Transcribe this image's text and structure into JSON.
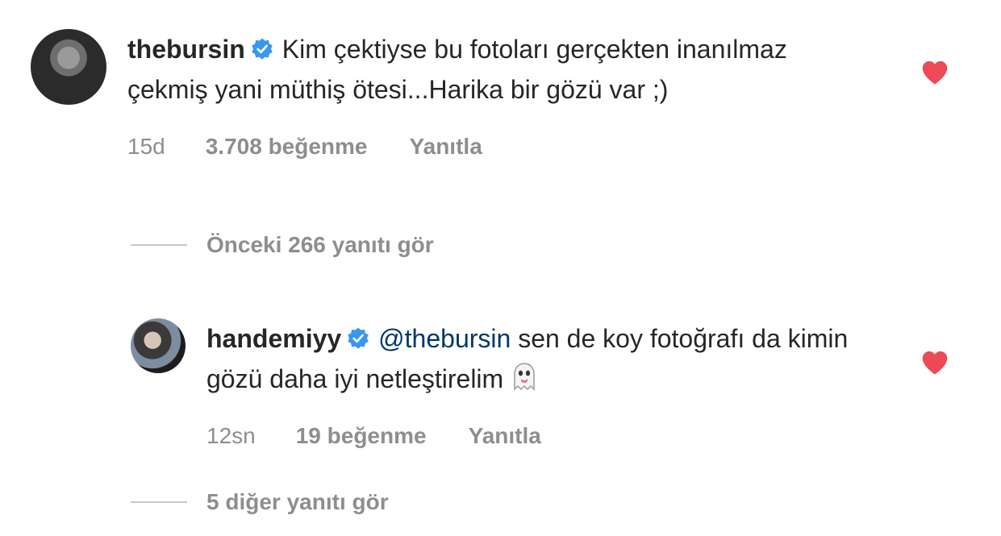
{
  "comments": [
    {
      "username": "thebursin",
      "verified": true,
      "text": "Kim çektiyse bu fotoları gerçekten inanılmaz çekmiş yani müthiş ötesi...Harika bir gözü var ;)",
      "time": "15d",
      "likes": "3.708 beğenme",
      "reply": "Yanıtla",
      "liked": true
    },
    {
      "username": "handemiyy",
      "verified": true,
      "mention": "@thebursin",
      "text": "sen de koy fotoğrafı da kimin gözü daha iyi netleştirelim",
      "emoji": "ghost",
      "time": "12sn",
      "likes": "19 beğenme",
      "reply": "Yanıtla",
      "liked": true
    }
  ],
  "view_previous": "Önceki 266 yanıtı gör",
  "view_more": "5 diğer yanıtı gör",
  "colors": {
    "heart": "#ed4956",
    "verified": "#3897f0",
    "mention": "#00376b",
    "meta": "#8e8e8e"
  }
}
